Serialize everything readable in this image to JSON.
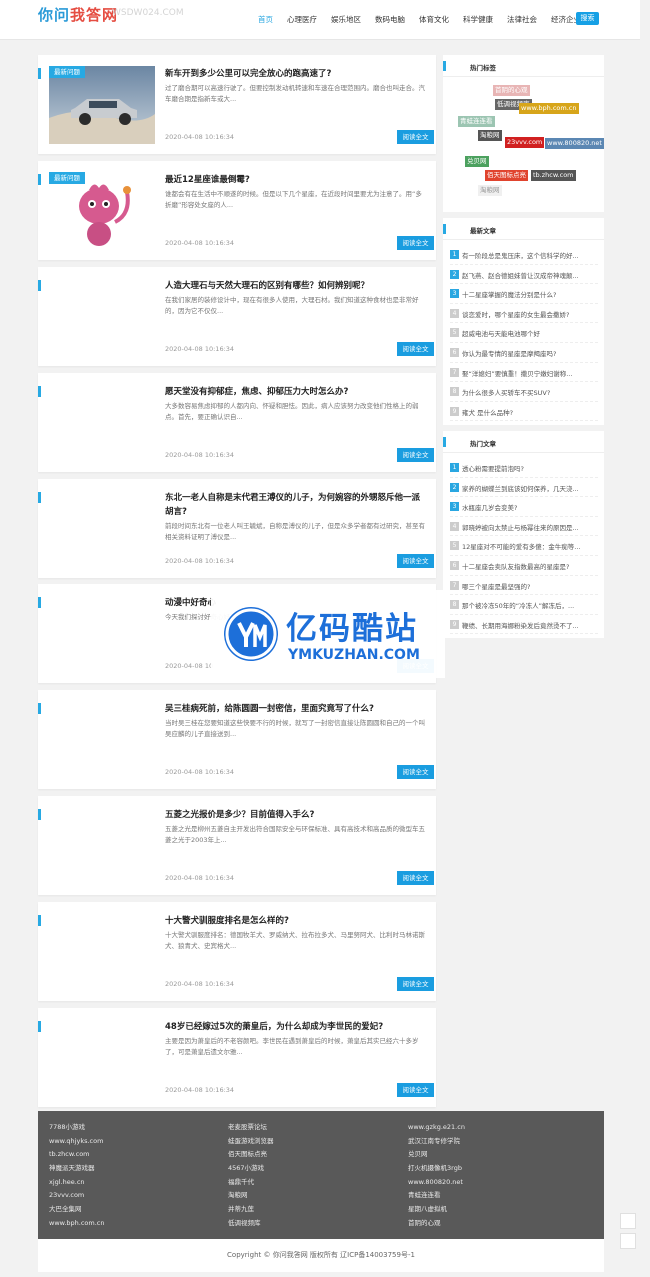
{
  "site": {
    "logo_blue": "你问",
    "logo_red": "我答网",
    "logo_domain": "WSDW024.COM"
  },
  "nav": {
    "items": [
      "首页",
      "心理医疗",
      "娱乐地区",
      "数码电脑",
      "体育文化",
      "科学健康",
      "法律社会",
      "经济企业"
    ],
    "active_index": 0,
    "search_label": "搜索"
  },
  "articles": [
    {
      "tag": "最新问题",
      "title": "新车开到多少公里可以完全放心的跑高速了?",
      "desc": "过了磨合期可以高速行驶了。但要控制发动机转速和车速在合理范围内。磨合也叫走合。汽车磨合期是指新车或大...",
      "date": "2020-04-08 10:16:34",
      "more": "阅读全文",
      "thumb": "car"
    },
    {
      "tag": "最新问题",
      "title": "最近12星座谁最倒霉?",
      "desc": "谁都会有在生活中不顺遂的时候。但是以下几个星座，在近段时间里要尤为注意了。用“多折磨”形容处女座的人...",
      "date": "2020-04-08 10:16:34",
      "more": "阅读全文",
      "thumb": "cartoon"
    },
    {
      "tag": "",
      "title": "人造大理石与天然大理石的区别有哪些？如何辨别呢？",
      "desc": "        在我们家居的装修设计中，现在有很多人使用，大理石材。我们知道这种食材也是非常好的，因为它不仅仅...",
      "date": "2020-04-08 10:16:34",
      "more": "阅读全文",
      "thumb": ""
    },
    {
      "tag": "",
      "title": "愿天堂没有抑郁症，焦虑、抑郁压力大时怎么办?",
      "desc": "大多数容易焦虑抑郁的人都内向、怀疑和胆怯。因此，病人应该努力改变他们性格上的弱点。首先，要正确认识自...",
      "date": "2020-04-08 10:16:34",
      "more": "阅读全文",
      "thumb": ""
    },
    {
      "tag": "",
      "title": "东北一老人自称是末代君王溥仪的儿子，为何婉容的外甥怒斥他一派胡言?",
      "desc": "前段时间东北有一位老人叫王毓斌，自称是溥仪的儿子，但是众多学者都有过研究，甚至有相关资料证明了溥仪是...",
      "date": "2020-04-08 10:16:34",
      "more": "阅读全文",
      "thumb": ""
    },
    {
      "tag": "",
      "title": "动漫中好奇心",
      "desc": "今天我们探讨好奇心好奇心的角色。",
      "date": "2020-04-08 10",
      "more": "阅读全文",
      "thumb": ""
    },
    {
      "tag": "",
      "title": "吴三桂病死前，给陈圆圆一封密信，里面究竟写了什么?",
      "desc": "当时吴三桂在您要知道这些快要不行的时候，就写了一封密信直接让陈圆圆和自己的一个叫吴应麟的儿子直接送到...",
      "date": "2020-04-08 10:16:34",
      "more": "阅读全文",
      "thumb": ""
    },
    {
      "tag": "",
      "title": "五菱之光报价是多少？目前值得入手么?",
      "desc": "五菱之光是柳州五菱自主开发出符合国际安全与环保标准、具有高技术和高品质的微型车五菱之光于2003年上...",
      "date": "2020-04-08 10:16:34",
      "more": "阅读全文",
      "thumb": ""
    },
    {
      "tag": "",
      "title": "十大警犬驯服度排名是怎么样的?",
      "desc": "十大警犬驯服度排名：德国牧羊犬、罗威纳犬、拉布拉多犬、马里努阿犬、比利时马林诺斯犬、狼青犬、史宾格犬...",
      "date": "2020-04-08 10:16:34",
      "more": "阅读全文",
      "thumb": ""
    },
    {
      "tag": "",
      "title": "48岁已经嫁过5次的萧皇后，为什么却成为李世民的爱妃?",
      "desc": "主要是因为萧皇后的不老容颜吧。李世民在遇到萧皇后的时候，萧皇后其实已经六十多岁了，可是萧皇后遗文尔雅...",
      "date": "2020-04-08 10:16:34",
      "more": "阅读全文",
      "thumb": ""
    }
  ],
  "sidebar": {
    "hot_tags_title": "热门标签",
    "hot_tags": [
      {
        "text": "首阴的心观",
        "color": "#e8b5b5"
      },
      {
        "text": "低调视频库",
        "color": "#666666"
      },
      {
        "text": "www.bph.com.cn",
        "color": "#d7a51a"
      },
      {
        "text": "青蛙连连看",
        "color": "#9cc5b2"
      },
      {
        "text": "淘粮网",
        "color": "#555555"
      },
      {
        "text": "23vvv.com",
        "color": "#d12020"
      },
      {
        "text": "www.800820.net",
        "color": "#5b87b3"
      },
      {
        "text": "兑贝网",
        "color": "#4ca15f"
      },
      {
        "text": "佰天图标点亮",
        "color": "#e0442e"
      },
      {
        "text": "tb.zhcw.com",
        "color": "#555555"
      },
      {
        "text": "淘粮网",
        "color": "#f0f0f0"
      }
    ],
    "latest_title": "最新文章",
    "latest": [
      "有一阶段总是鬼压床，这个信科学的好...",
      "赵飞燕、赵合德姐妹曾让汉成帝神魂颠...",
      "十二星座掌握的魔法分别是什么?",
      "谈恋爱时，哪个星座的女生最会撒娇?",
      "超威电池与天能电池哪个好",
      "你认为最专情的星座是摩羯座吗?",
      "娶“洋媳妇”要慎重！撒贝宁嫩妇谢称...",
      "为什么很多人买轿车不买SUV?",
      "雍犬 是什么品种?"
    ],
    "hot_title": "热门文章",
    "hot": [
      "透心粉需要提前泡吗?",
      "家养的蝴蝶兰到底该如何保养，几天浇...",
      "水瓶座几岁会变美?",
      "郭晓婷被向太禁止与杨幂往来的原因是...",
      "12星座对不可能的爱有多傻：金牛痴等...",
      "十二星座会卖队友指数最高的星座是?",
      "哪三个星座是最坚强的?",
      "那个被冷冻50年的“冷冻人”解冻后，...",
      "鞭绩、长期用海娜粉染发后竟然烫不了..."
    ]
  },
  "footer": {
    "col1": [
      "7788小游戏",
      "www.qhjyks.com",
      "tb.zhcw.com",
      "神魔派天游戏器",
      "xjgl.hee.cn",
      "23vvv.com",
      "大巴全集网",
      "www.bph.com.cn"
    ],
    "col2": [
      "老麦股票论坛",
      "蛙蛋游戏浏览器",
      "佰天图标点亮",
      "4567小游戏",
      "福鼎千代",
      "淘粮网",
      "并蒂九莲",
      "低调视频库"
    ],
    "col3": [
      "www.gzkg.e21.cn",
      "武汉江南专修学院",
      "兑贝网",
      "打火机摄像机3rgb",
      "www.800820.net",
      "青蛙连连看",
      "星期八虚拟机",
      "首阴的心观"
    ],
    "copyright": "Copyright © 你问我答网 版权所有 辽ICP备14003759号-1"
  },
  "watermark": {
    "cn": "亿码酷站",
    "en": "YMKUZHAN.COM"
  }
}
